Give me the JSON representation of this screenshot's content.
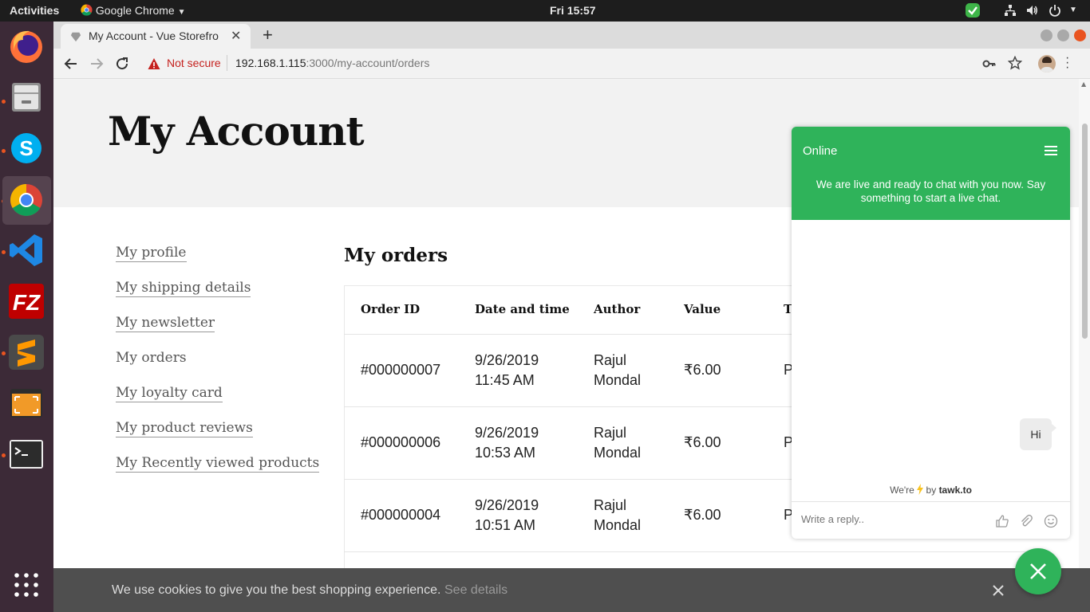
{
  "os": {
    "activities": "Activities",
    "app_name": "Google Chrome",
    "clock": "Fri 15:57"
  },
  "browser": {
    "tab_title": "My Account - Vue Storefro",
    "security_label": "Not secure",
    "url_host": "192.168.1.115",
    "url_path": ":3000/my-account/orders"
  },
  "page": {
    "title": "My Account",
    "section_title": "My orders",
    "nav": [
      "My profile",
      "My shipping details",
      "My newsletter",
      "My orders",
      "My loyalty card",
      "My product reviews",
      "My Recently viewed products"
    ],
    "table": {
      "headers": [
        "Order ID",
        "Date and time",
        "Author",
        "Value",
        "T"
      ],
      "rows": [
        {
          "id": "#000000007",
          "date": "9/26/2019",
          "time": "11:45 AM",
          "author_first": "Rajul",
          "author_last": "Mondal",
          "value": "₹6.00",
          "type": "P"
        },
        {
          "id": "#000000006",
          "date": "9/26/2019",
          "time": "10:53 AM",
          "author_first": "Rajul",
          "author_last": "Mondal",
          "value": "₹6.00",
          "type": "P"
        },
        {
          "id": "#000000004",
          "date": "9/26/2019",
          "time": "10:51 AM",
          "author_first": "Rajul",
          "author_last": "Mondal",
          "value": "₹6.00",
          "type": "P"
        }
      ]
    }
  },
  "cookie": {
    "message": "We use cookies to give you the best shopping experience.",
    "link": "See details"
  },
  "chat": {
    "status": "Online",
    "intro": "We are live and ready to chat with you now. Say something to start a live chat.",
    "message": "Hi",
    "brand_prefix": "We're",
    "brand_by": "by",
    "brand_name": "tawk.to",
    "placeholder": "Write a reply.."
  },
  "colors": {
    "chat_green": "#2fb35a",
    "warning_red": "#c5221f"
  }
}
